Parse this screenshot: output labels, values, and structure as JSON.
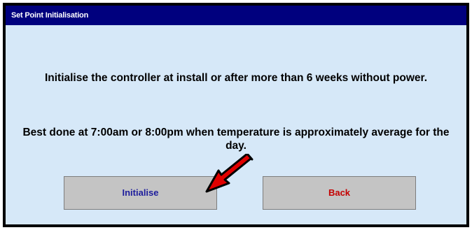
{
  "window": {
    "title": "Set Point Initialisation"
  },
  "messages": {
    "line1": "Initialise the controller at install or after more than 6 weeks without power.",
    "line2": "Best done at 7:00am or 8:00pm when temperature is approximately average for the day."
  },
  "buttons": {
    "initialise_label": "Initialise",
    "back_label": "Back"
  },
  "annotation": {
    "arrow_icon": "red-arrow-icon",
    "arrow_color": "#e00000",
    "points_to": "Initialise"
  },
  "colors": {
    "titlebar": "#00007e",
    "panel_background": "#d6e8f8",
    "button_background": "#c4c4c4",
    "initialise_text": "#1d1d9c",
    "back_text": "#c40000"
  }
}
